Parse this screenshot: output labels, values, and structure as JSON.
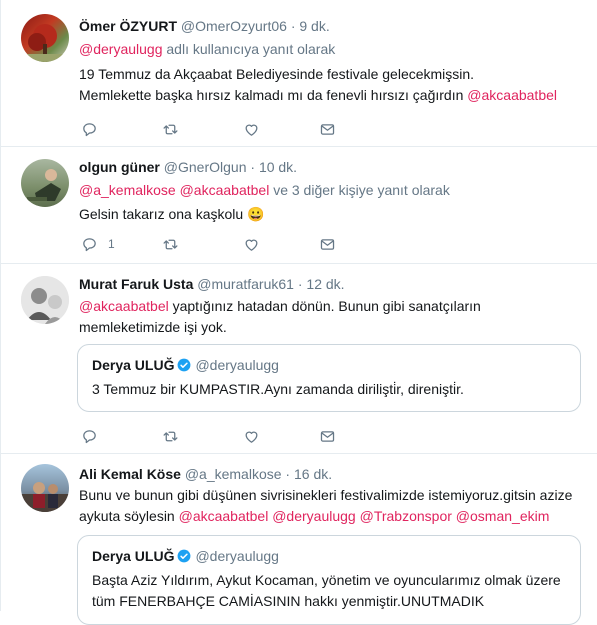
{
  "tweets": [
    {
      "name": "Ömer ÖZYURT",
      "handle": "@OmerOzyurt06",
      "sep": "·",
      "time": "9 dk.",
      "reply_to": "@deryaulugg",
      "reply_suffix": " adlı kullanıcıya yanıt olarak",
      "line1": "19 Temmuz da Akçaabat Belediyesinde festivale gelecekmişsin.",
      "line2_text": "Memlekette başka hırsız kalmadı mı da fenevli hırsızı çağırdın ",
      "line2_mention": "@akcaabatbel"
    },
    {
      "name": "olgun güner",
      "handle": "@GnerOlgun",
      "sep": "·",
      "time": "10 dk.",
      "reply_to_1": "@a_kemalkose",
      "reply_to_2": "@akcaabatbel",
      "reply_suffix": " ve 3 diğer kişiye yanıt olarak",
      "text": "Gelsin takarız ona kaşkolu ",
      "emoji": "😀",
      "reply_count": "1"
    },
    {
      "name": "Murat Faruk Usta",
      "handle": "@muratfaruk61",
      "sep": "·",
      "time": "12 dk.",
      "mention": "@akcaabatbel",
      "line1_rest": " yaptığınız hatadan dönün. Bunun gibi sanatçıların",
      "line2": "memleketimizde işi yok.",
      "quote": {
        "name": "Derya ULUĞ",
        "handle": "@deryaulugg",
        "text": "3 Temmuz bir KUMPASTIR.Aynı zamanda dirilişti̇r, direnişti̇r."
      }
    },
    {
      "name": "Ali Kemal Köse",
      "handle": "@a_kemalkose",
      "sep": "·",
      "time": "16 dk.",
      "line1": "Bunu ve bunun gibi düşünen sivrisinekleri festivalimizde istemiyoruz.gitsin azize",
      "line2_text": "aykuta söylesin ",
      "mention1": "@akcaabatbel",
      "mention2": "@deryaulugg",
      "mention3": "@Trabzonspor",
      "mention4": "@osman_ekim",
      "quote": {
        "name": "Derya ULUĞ",
        "handle": "@deryaulugg",
        "line1": "Başta Aziz Yıldırım, Aykut Kocaman, yönetim ve oyuncularımız olmak üzere",
        "line2": "tüm FENERBAHÇE CAMİASININ hakkı yenmiştir.UNUTMADIK"
      }
    }
  ],
  "colors": {
    "mention": "#e0245e",
    "muted": "#657786",
    "text": "#14171a",
    "verified": "#1da1f2"
  },
  "icons": [
    "reply-icon",
    "retweet-icon",
    "like-icon",
    "message-icon",
    "verified-icon"
  ]
}
